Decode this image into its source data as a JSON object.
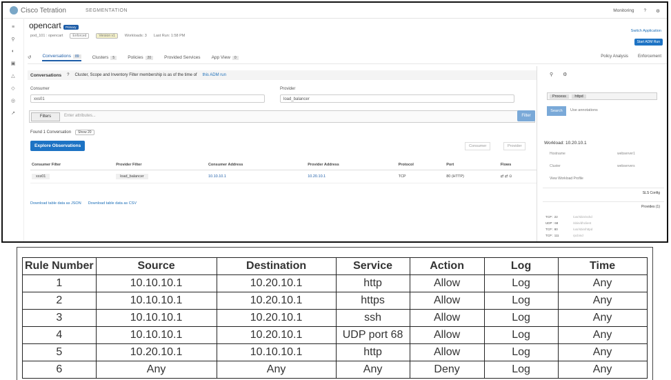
{
  "topbar": {
    "brand": "Cisco Tetration",
    "module": "SEGMENTATION",
    "user": "Monitoring",
    "help": "?",
    "settings": "⚙"
  },
  "app": {
    "title": "opencart",
    "badge": "Primary",
    "crumb": "pod_101 : opencart",
    "enforced": "Enforced",
    "version": "Version v1",
    "workloads": "Workloads: 3",
    "last_run": "Last Run: 1:58 PM",
    "switch_app": "Switch Application",
    "adm_button": "Start ADM Run"
  },
  "tabs": [
    {
      "label": "Conversations",
      "count": "89"
    },
    {
      "label": "Clusters",
      "count": "5"
    },
    {
      "label": "Policies",
      "count": "20"
    },
    {
      "label": "Provided Services",
      "count": ""
    },
    {
      "label": "App View",
      "count": "0"
    }
  ],
  "tabs_right": {
    "policy_analysis": "Policy Analysis",
    "enforcement": "Enforcement"
  },
  "conversations": {
    "header": "Conversations",
    "header_count": "?",
    "note": "Cluster, Scope and Inventory Filter membership is as of the time of",
    "note_link": "this ADM run",
    "consumer_label": "Consumer",
    "consumer_value": "xxs01",
    "provider_label": "Provider",
    "provider_value": "load_balancer",
    "filters_button": "Filters",
    "filters_placeholder": "Enter attributes...",
    "filter_go": "Filter",
    "found": "Found 1 Conversation",
    "show": "Show 20",
    "explore": "Explore Observations",
    "consumer_toggle": "Consumer",
    "provider_toggle": "Provider",
    "columns": [
      "Consumer Filter",
      "Provider Filter",
      "Consumer Address",
      "Provider Address",
      "Protocol",
      "Port",
      "Flows"
    ],
    "rows": [
      {
        "consumer_filter": "xxs01",
        "provider_filter": "load_balancer",
        "consumer_address": "10.10.10.1",
        "provider_address": "10.20.10.1",
        "protocol": "TCP",
        "port": "80 (HTTP)",
        "flows": "⇄ ⇄ ⊙"
      }
    ],
    "download_json": "Download table data as JSON",
    "download_csv": "Download table data as CSV"
  },
  "side_panel": {
    "process_label": "Process",
    "process_value": "httpd",
    "search_button": "Search",
    "search_note": "Use annotations",
    "workload_title": "Workload: 10.20.10.1",
    "hostname_label": "Hostname",
    "hostname_value": "webserver1",
    "cluster_label": "Cluster",
    "cluster_value": "webservers",
    "profile_link": "View Workload Profile",
    "sls_config": "SLS Config",
    "provides": "Provides (1)",
    "ports": [
      {
        "proto": "TCP",
        "port": "22",
        "desc": "/usr/sbin/sshd"
      },
      {
        "proto": "UDP",
        "port": "68",
        "desc": "/sbin/dhclient"
      },
      {
        "proto": "TCP",
        "port": "80",
        "desc": "/usr/sbin/httpd"
      },
      {
        "proto": "TCP",
        "port": "111",
        "desc": "rpcbind"
      }
    ]
  },
  "rules": {
    "headers": [
      "Rule Number",
      "Source",
      "Destination",
      "Service",
      "Action",
      "Log",
      "Time"
    ],
    "rows": [
      [
        "1",
        "10.10.10.1",
        "10.20.10.1",
        "http",
        "Allow",
        "Log",
        "Any"
      ],
      [
        "2",
        "10.10.10.1",
        "10.20.10.1",
        "https",
        "Allow",
        "Log",
        "Any"
      ],
      [
        "3",
        "10.10.10.1",
        "10.20.10.1",
        "ssh",
        "Allow",
        "Log",
        "Any"
      ],
      [
        "4",
        "10.10.10.1",
        "10.20.10.1",
        "UDP port 68",
        "Allow",
        "Log",
        "Any"
      ],
      [
        "5",
        "10.20.10.1",
        "10.10.10.1",
        "http",
        "Allow",
        "Log",
        "Any"
      ],
      [
        "6",
        "Any",
        "Any",
        "Any",
        "Deny",
        "Log",
        "Any"
      ]
    ]
  }
}
